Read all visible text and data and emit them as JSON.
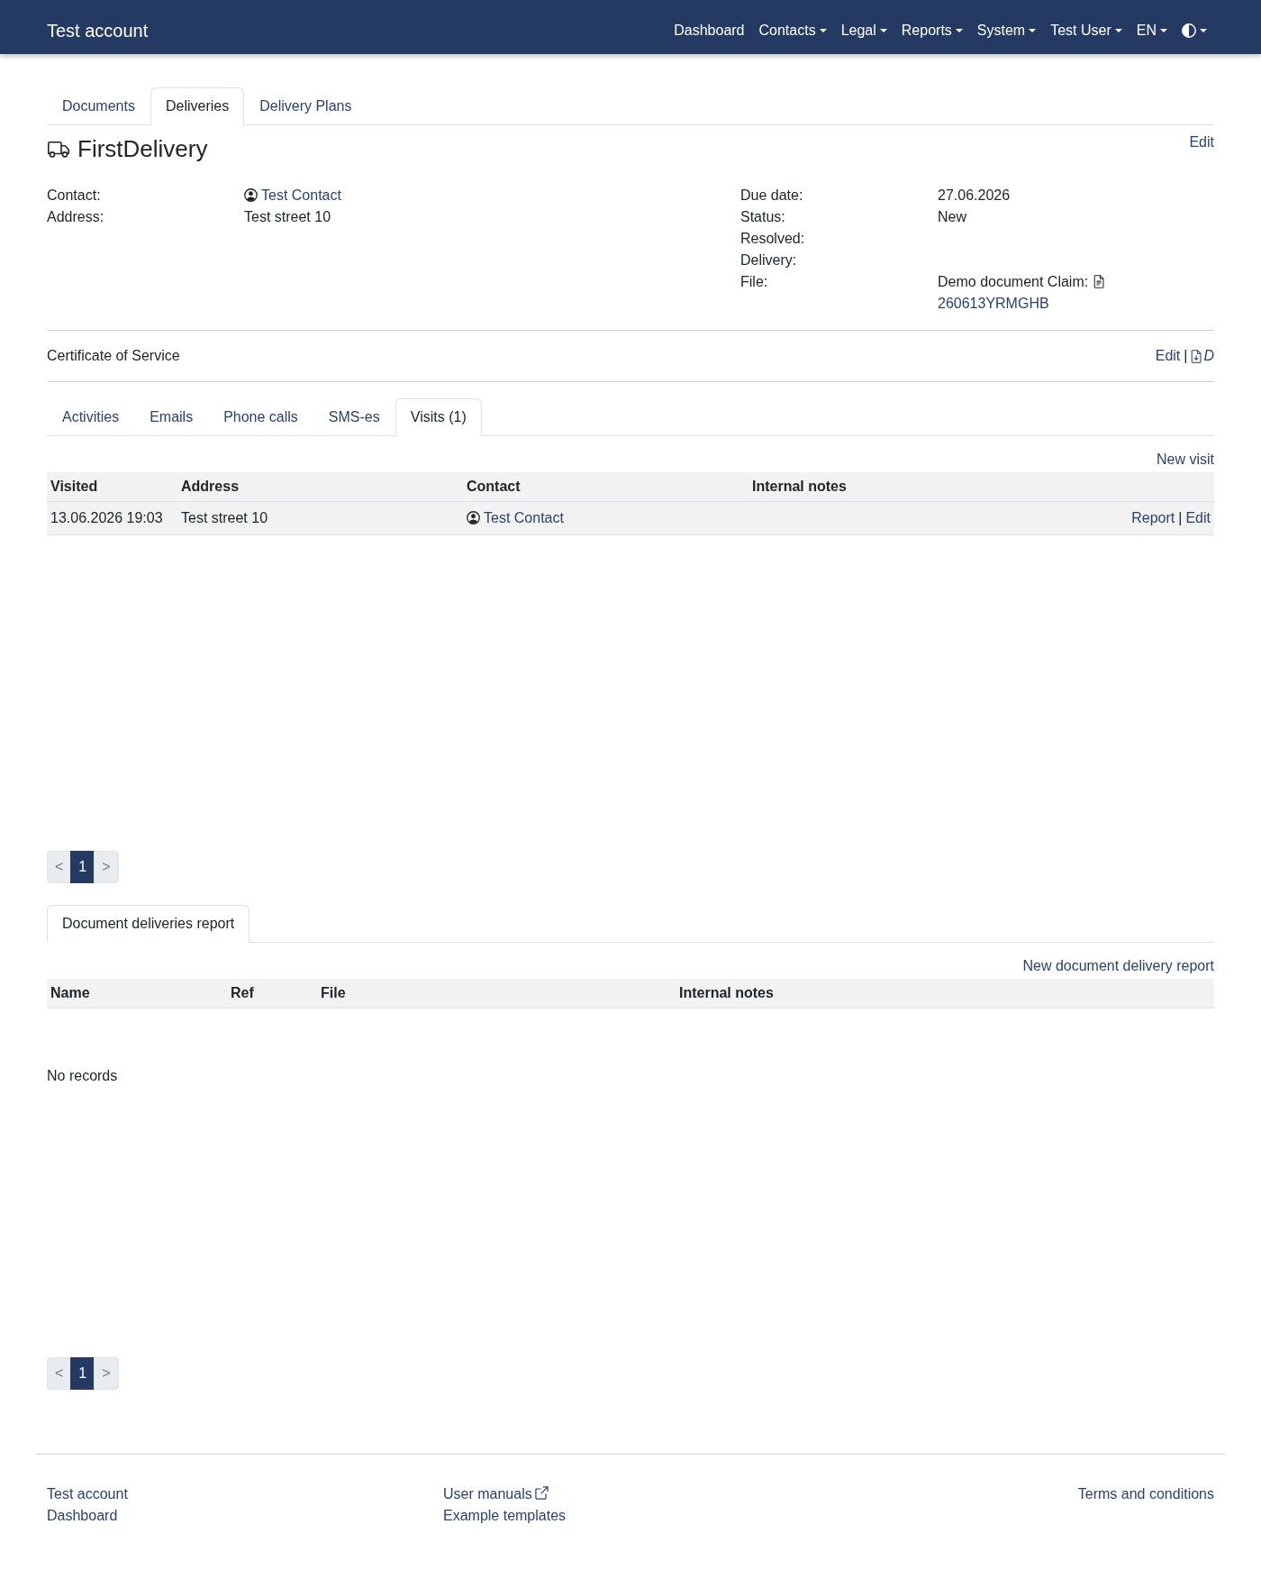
{
  "navbar": {
    "brand": "Test account",
    "items": [
      {
        "label": "Dashboard",
        "dropdown": false
      },
      {
        "label": "Contacts",
        "dropdown": true
      },
      {
        "label": "Legal",
        "dropdown": true
      },
      {
        "label": "Reports",
        "dropdown": true
      },
      {
        "label": "System",
        "dropdown": true
      },
      {
        "label": "Test User",
        "dropdown": true
      },
      {
        "label": "EN",
        "dropdown": true
      }
    ],
    "theme_toggle": {
      "dropdown": true
    }
  },
  "tabs": [
    {
      "label": "Documents",
      "selected": false
    },
    {
      "label": "Deliveries",
      "selected": true
    },
    {
      "label": "Delivery Plans",
      "selected": false
    }
  ],
  "delivery": {
    "title": "FirstDelivery",
    "edit_link": "Edit",
    "details_left": [
      {
        "kind": "contact",
        "label": "Contact:",
        "value": "Test Contact"
      },
      {
        "kind": "text",
        "label": "Address:",
        "value": "Test street 10"
      }
    ],
    "details_right": [
      {
        "kind": "text",
        "label": "Due date:",
        "value": "27.06.2026"
      },
      {
        "kind": "text",
        "label": "Status:",
        "value": "New"
      },
      {
        "kind": "text",
        "label": "Resolved:"
      },
      {
        "kind": "text",
        "label": "Delivery:"
      },
      {
        "kind": "file",
        "label": "File:",
        "value": "Demo document Claim:",
        "link": "260613YRMGHB"
      }
    ]
  },
  "certificate": {
    "title": "Certificate of Service",
    "separator": "|",
    "links": [
      {
        "kind": "edit",
        "label": "Edit"
      },
      {
        "kind": "download",
        "label": "D"
      }
    ]
  },
  "sub_tabs": [
    {
      "label": "Activities",
      "selected": false
    },
    {
      "label": "Emails",
      "selected": false
    },
    {
      "label": "Phone calls",
      "selected": false
    },
    {
      "label": "SMS-es",
      "selected": false
    },
    {
      "label": "Visits (1)",
      "selected": true
    }
  ],
  "visits": {
    "new_link": "New visit",
    "columns": [
      "Visited",
      "Address",
      "Contact",
      "Internal notes"
    ],
    "action_separator": "|",
    "rows": [
      {
        "visited": "13.06.2026 19:03",
        "address": "Test street 10",
        "contact": "Test Contact",
        "actions": [
          "Report",
          "Edit"
        ]
      }
    ],
    "pagination": {
      "prev": "<",
      "next": ">",
      "pages": [
        {
          "label": "1",
          "selected": true
        }
      ]
    }
  },
  "report_tabs": [
    {
      "label": "Document deliveries report",
      "selected": true
    }
  ],
  "reports": {
    "new_link": "New document delivery report",
    "columns": [
      "Name",
      "Ref",
      "File",
      "Internal notes"
    ],
    "empty_text": "No records",
    "pagination": {
      "prev": "<",
      "next": ">",
      "pages": [
        {
          "label": "1",
          "selected": true
        }
      ]
    }
  },
  "footer": {
    "columns": [
      {
        "links": [
          {
            "label": "Test account",
            "external": false
          },
          {
            "label": "Dashboard",
            "external": false
          }
        ]
      },
      {
        "links": [
          {
            "label": "User manuals",
            "external": true
          },
          {
            "label": "Example templates",
            "external": false
          }
        ]
      },
      {
        "links": [
          {
            "label": "Terms and conditions",
            "external": false
          }
        ]
      }
    ]
  }
}
